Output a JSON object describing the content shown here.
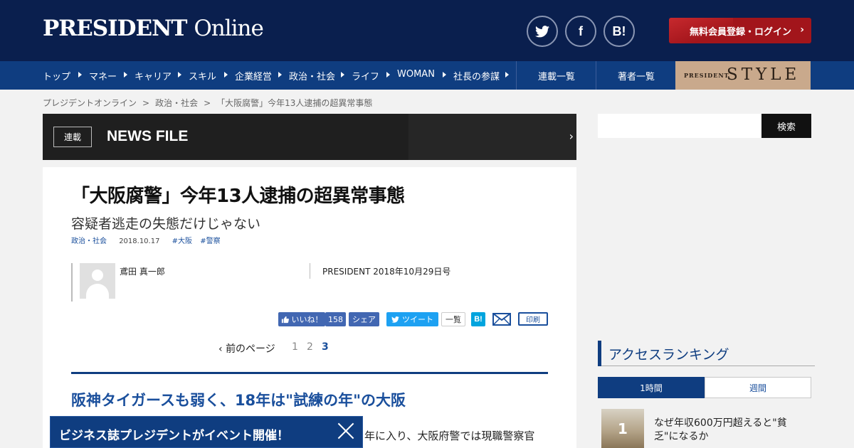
{
  "header": {
    "logo_bold": "PRESIDENT",
    "logo_light": "Online",
    "social": [
      "twitter-icon",
      "facebook-icon",
      "hatena-bookmark-icon"
    ],
    "social_glyphs": [
      "",
      "f",
      "B!"
    ],
    "login_label": "無料会員登録・ログイン",
    "colors": {
      "header_bg": "#0a1f4e",
      "nav_bg": "#0f3d80",
      "login_bg": "#a2151b",
      "style_bg": "#c9a98c"
    }
  },
  "nav": {
    "items": [
      "トップ",
      "マネー",
      "キャリア",
      "スキル",
      "企業経営",
      "政治・社会",
      "ライフ",
      "WOMAN",
      "社長の参謀"
    ],
    "series_list": "連載一覧",
    "authors_list": "著者一覧",
    "style_small": "PRESIDENT",
    "style_big": "STYLE"
  },
  "breadcrumb": {
    "items": [
      "プレジデントオンライン",
      "政治・社会",
      "「大阪腐警」今年13人逮捕の超異常事態"
    ],
    "separator": ">"
  },
  "series": {
    "tag": "連載",
    "title": "NEWS FILE"
  },
  "search": {
    "button_label": "検索"
  },
  "article": {
    "title": "「大阪腐警」今年13人逮捕の超異常事態",
    "subtitle": "容疑者逃走の失態だけじゃない",
    "category": "政治・社会",
    "date": "2018.10.17",
    "tags": [
      "#大阪",
      "#警察"
    ],
    "author": "鳶田 真一郎",
    "issue": "PRESIDENT 2018年10月29日号",
    "share": {
      "like_label": "いいね！",
      "like_count": "158",
      "share_label": "シェア",
      "tweet_label": "ツイート",
      "list_label": "一覧",
      "hatena_label": "B!",
      "print_label": "印刷"
    },
    "pagination": {
      "prev_label": "前のページ",
      "pages": [
        "1",
        "2",
        "3"
      ],
      "current": "3"
    },
    "section_heading": "阪神タイガースも弱く、18年は\"試練の年\"の大阪",
    "body_line1": "年に入り、大阪府警では現職警察官"
  },
  "event_banner": {
    "text": "ビジネス誌プレジデントがイベント開催！"
  },
  "ranking": {
    "title": "アクセスランキング",
    "tabs": [
      "1時間",
      "週間"
    ],
    "active_tab": "1時間",
    "items": [
      {
        "rank": "1",
        "title": "なぜ年収600万円超えると\"貧乏\"になるか"
      }
    ]
  }
}
